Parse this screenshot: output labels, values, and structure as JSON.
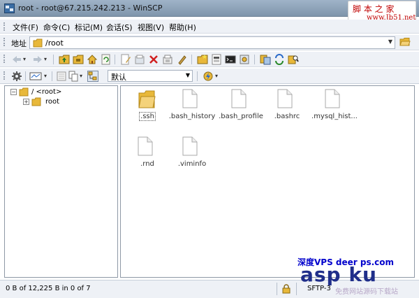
{
  "window": {
    "title": "root - root@67.215.242.213 - WinSCP",
    "watermark_line1": "脚 本 之 家",
    "watermark_line2": "www.Jb51.net"
  },
  "menu": {
    "items": [
      {
        "label": "文件(F)"
      },
      {
        "label": "命令(C)"
      },
      {
        "label": "标记(M)"
      },
      {
        "label": "会话(S)"
      },
      {
        "label": "视图(V)"
      },
      {
        "label": "帮助(H)"
      }
    ]
  },
  "address": {
    "label": "地址",
    "value": "/root"
  },
  "toolbar": {
    "profile_value": "默认"
  },
  "tree": {
    "root_label": "/ <root>",
    "child_label": "root",
    "root_expander": "−",
    "child_expander": "+"
  },
  "files": [
    {
      "name": ".ssh",
      "type": "folder"
    },
    {
      "name": ".bash_history",
      "type": "file"
    },
    {
      "name": ".bash_profile",
      "type": "file"
    },
    {
      "name": ".bashrc",
      "type": "file"
    },
    {
      "name": ".mysql_hist...",
      "type": "file"
    },
    {
      "name": ".rnd",
      "type": "file"
    },
    {
      "name": ".viminfo",
      "type": "file"
    }
  ],
  "status": {
    "selection": "0 B of 12,225 B in 0 of 7",
    "protocol": "SFTP-3"
  },
  "brand": {
    "top": "深度VPS deer  ps.com",
    "big": "asp ku",
    "sub": "免费网站源码下载站"
  },
  "colors": {
    "folder": "#e8b83a",
    "accent_blue": "#1f2e8a",
    "watermark_red": "#c00000"
  },
  "icons": {
    "toolbar1": [
      "back-icon",
      "forward-icon",
      "parent-dir-icon",
      "root-dir-icon",
      "home-icon",
      "refresh-icon",
      "edit-icon",
      "open-icon",
      "delete-icon",
      "rename-icon",
      "properties-icon",
      "create-dir-icon",
      "add-bookmark-icon",
      "terminal-icon",
      "preferences-icon",
      "synchronize-icon",
      "compare-icon",
      "find-icon"
    ],
    "toolbar2": [
      "gear-icon",
      "view-icon",
      "filter-icon",
      "sort-icon",
      "tree-icon",
      "transfer-icon"
    ]
  }
}
